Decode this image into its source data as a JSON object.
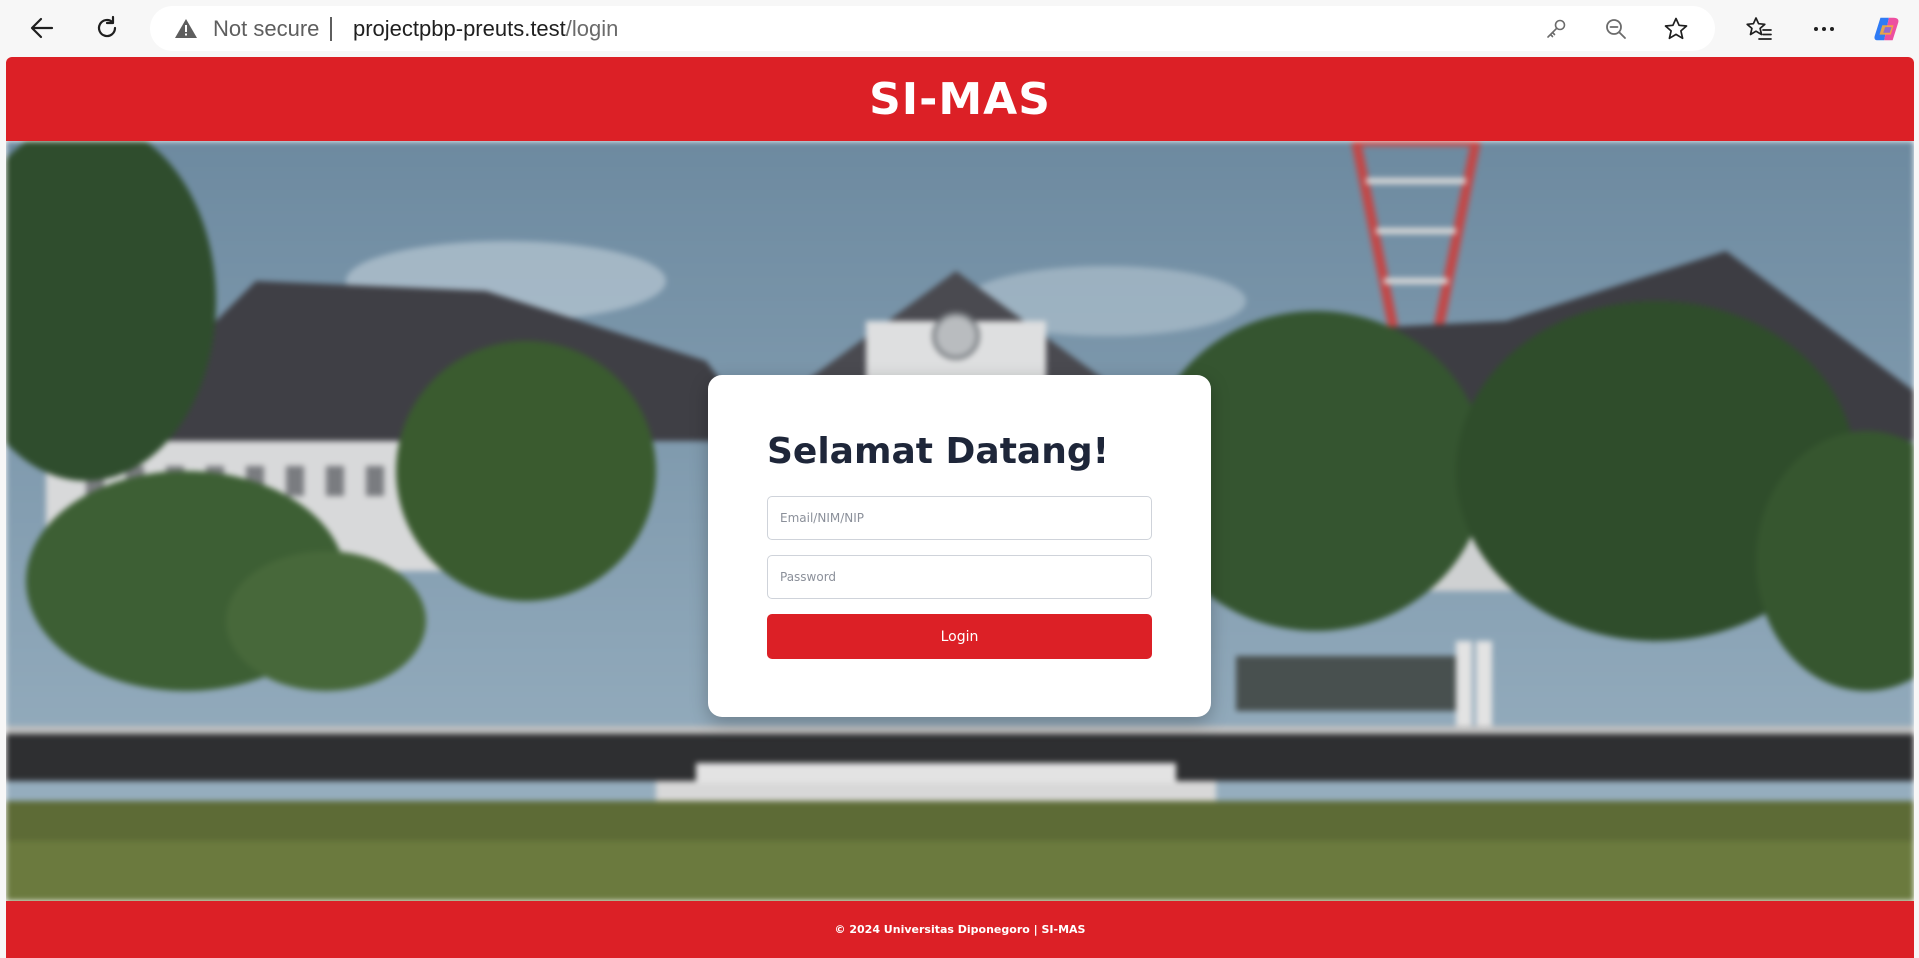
{
  "browser": {
    "security_label": "Not secure",
    "url_host": "projectpbp-preuts.test",
    "url_path": "/login",
    "icons": [
      "back-icon",
      "refresh-icon",
      "warning-icon",
      "key-icon",
      "zoom-out-icon",
      "favorite-star-icon",
      "favorites-list-icon",
      "more-icon",
      "copilot-icon"
    ]
  },
  "site": {
    "title": "SI-MAS",
    "brand_color": "#dc2026"
  },
  "login": {
    "heading": "Selamat Datang!",
    "username_placeholder": "Email/NIM/NIP",
    "password_placeholder": "Password",
    "submit_label": "Login"
  },
  "footer": {
    "text": "© 2024 Universitas Diponegoro | SI-MAS"
  }
}
